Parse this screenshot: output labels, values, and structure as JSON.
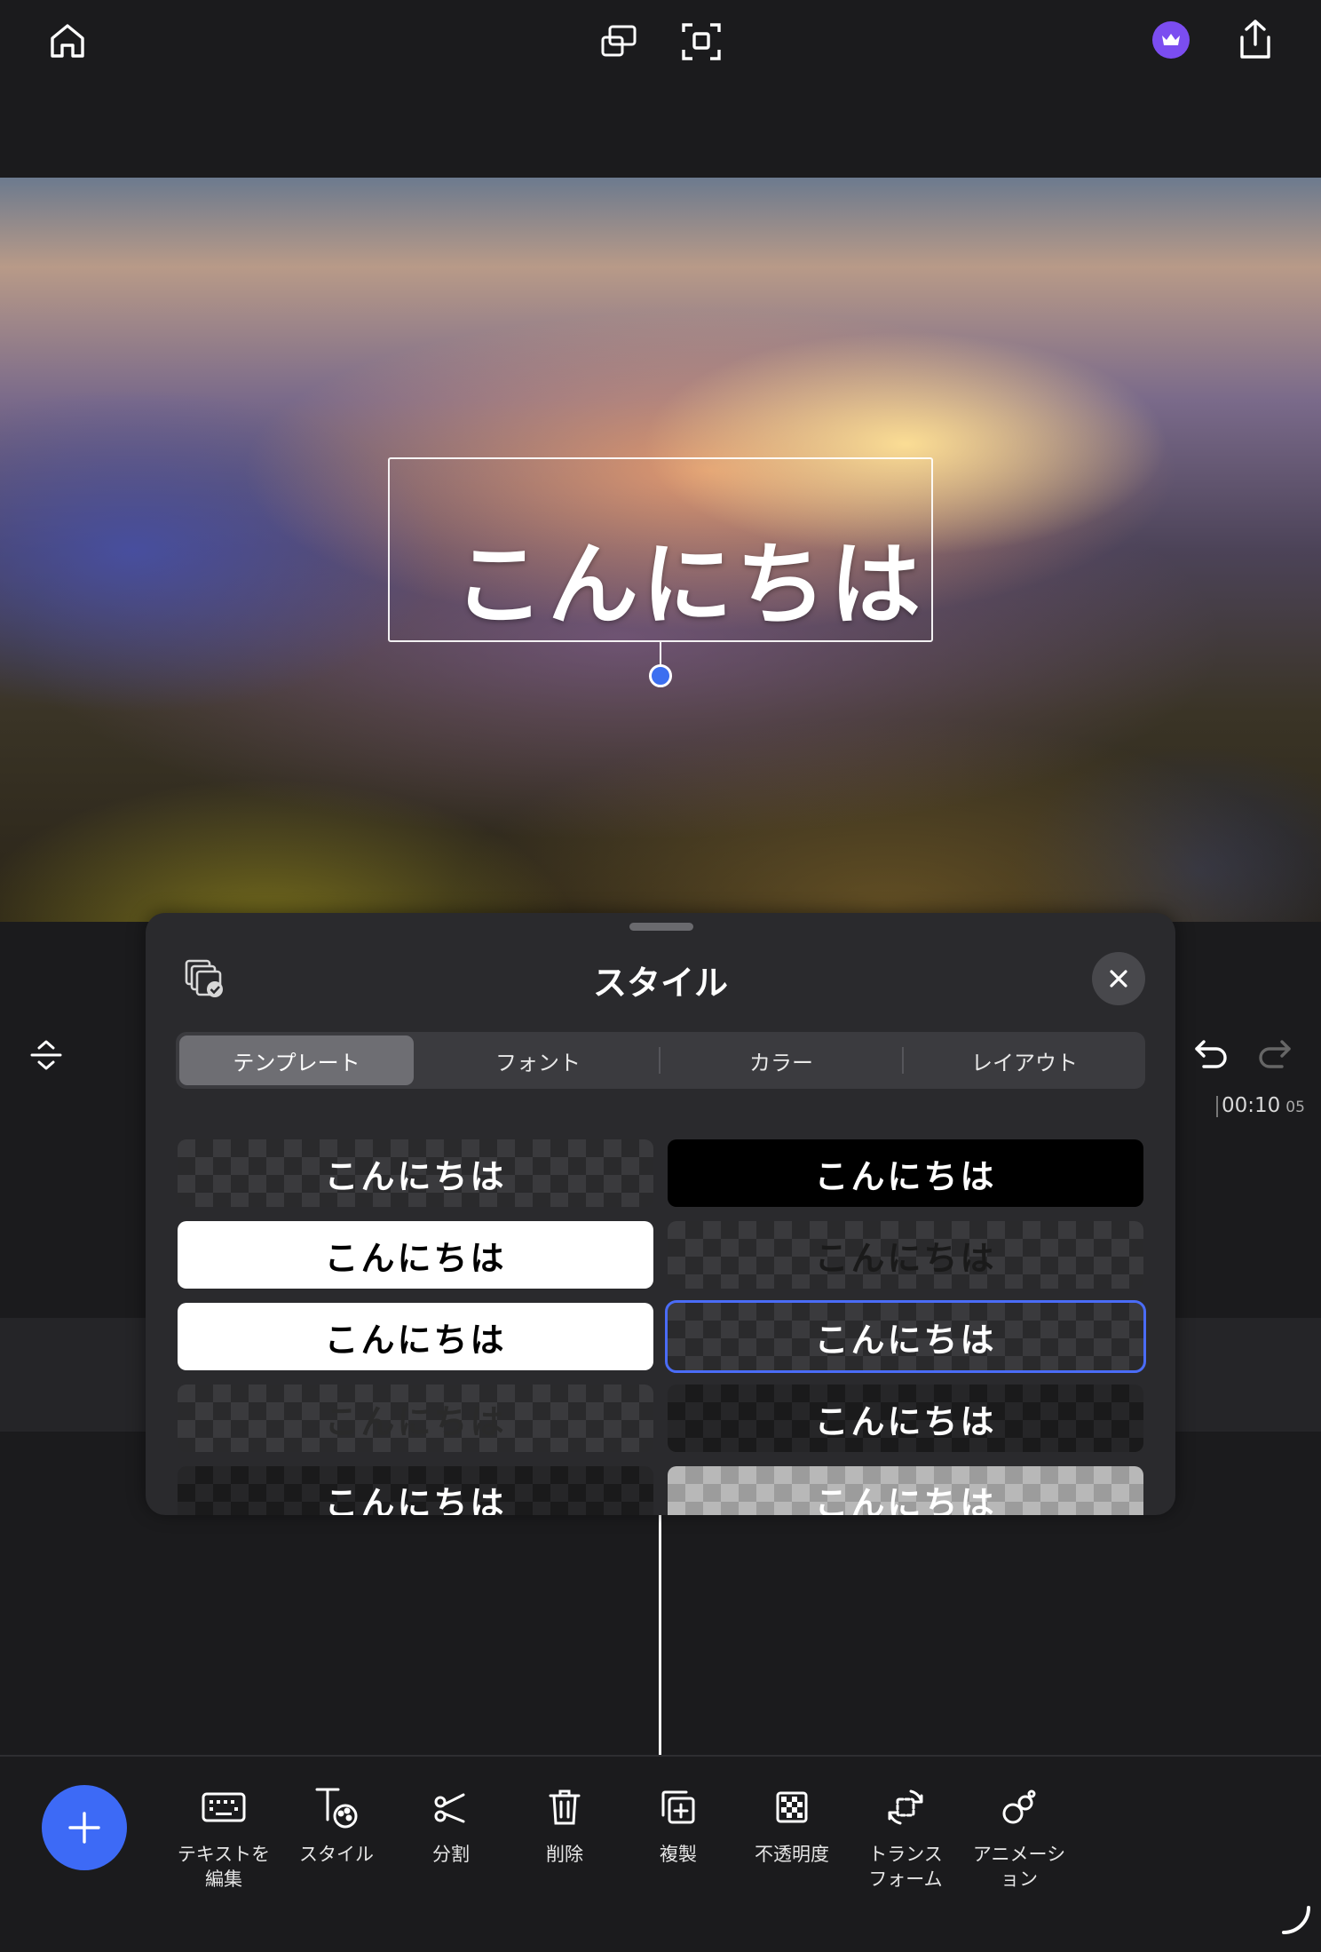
{
  "colors": {
    "accent": "#3d6af6",
    "background": "#1b1b1d",
    "panel": "#2a2a2d",
    "premium": "#7b4df0"
  },
  "preview": {
    "overlay_text": "こんにちは"
  },
  "timeline": {
    "time_main": "00:10",
    "time_frames": "05"
  },
  "style_panel": {
    "title": "スタイル",
    "tabs": [
      {
        "label": "テンプレート",
        "active": true
      },
      {
        "label": "フォント",
        "active": false
      },
      {
        "label": "カラー",
        "active": false
      },
      {
        "label": "レイアウト",
        "active": false
      }
    ],
    "templates": [
      {
        "text": "こんにちは",
        "style": "checker-white-text"
      },
      {
        "text": "こんにちは",
        "style": "black-bg-white-text"
      },
      {
        "text": "こんにちは",
        "style": "white-bg-black-text"
      },
      {
        "text": "こんにちは",
        "style": "checker-dark-text"
      },
      {
        "text": "こんにちは",
        "style": "white-bg-black-text-2"
      },
      {
        "text": "こんにちは",
        "style": "checker-white-outlined",
        "selected": true
      },
      {
        "text": "こんにちは",
        "style": "checker-faint-text"
      },
      {
        "text": "こんにちは",
        "style": "dark-checker-white-text"
      },
      {
        "text": "こんにちは",
        "style": "dark-checker-white-text-2"
      },
      {
        "text": "こんにちは",
        "style": "light-checker-white-text"
      }
    ]
  },
  "toolbar": {
    "tools": [
      {
        "label": "テキストを\n編集",
        "icon": "keyboard-icon"
      },
      {
        "label": "スタイル",
        "icon": "text-style-icon"
      },
      {
        "label": "分割",
        "icon": "scissors-icon"
      },
      {
        "label": "削除",
        "icon": "trash-icon"
      },
      {
        "label": "複製",
        "icon": "duplicate-icon"
      },
      {
        "label": "不透明度",
        "icon": "opacity-icon"
      },
      {
        "label": "トランス\nフォーム",
        "icon": "transform-icon"
      },
      {
        "label": "アニメーシ\nョン",
        "icon": "animation-icon"
      }
    ]
  }
}
